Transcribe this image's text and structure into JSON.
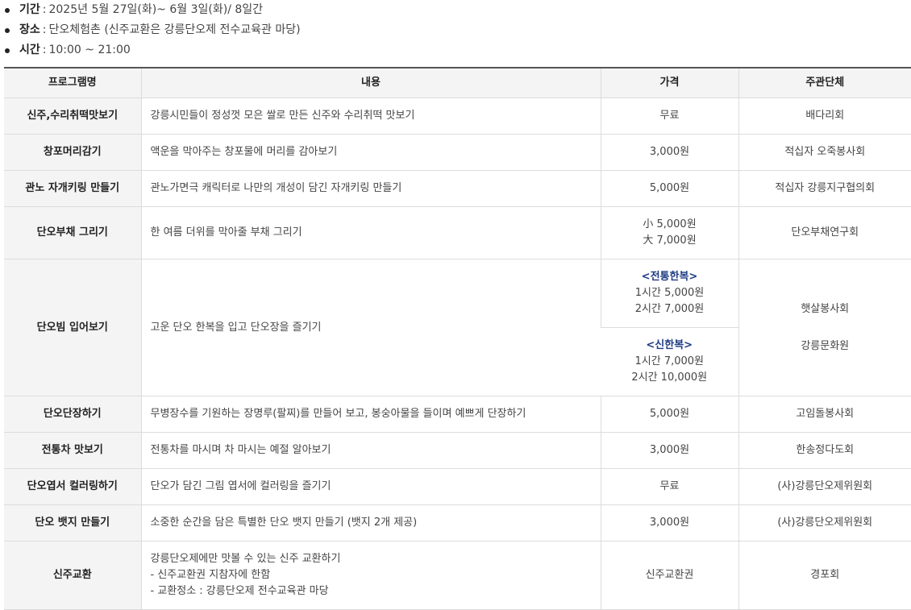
{
  "info": [
    {
      "label": "기간",
      "value": "2025년 5월 27일(화)~ 6월 3일(화)/ 8일간"
    },
    {
      "label": "장소",
      "value": "단오체험촌 (신주교환은 강릉단오제 전수교육관 마당)"
    },
    {
      "label": "시간",
      "value": "10:00 ~ 21:00"
    }
  ],
  "table": {
    "headers": [
      "프로그램명",
      "내용",
      "가격",
      "주관단체"
    ],
    "rows": [
      {
        "name": "신주,수리취떡맛보기",
        "content": "강릉시민들이 정성껏 모은 쌀로 만든 신주와 수리취떡 맛보기",
        "price": "무료",
        "org": "배다리회"
      },
      {
        "name": "창포머리감기",
        "content": "액운을 막아주는 창포물에 머리를 감아보기",
        "price": "3,000원",
        "org": "적십자 오죽봉사회"
      },
      {
        "name": "관노 자개키링 만들기",
        "content": "관노가면극 캐릭터로 나만의 개성이 담긴 자개키링 만들기",
        "price": "5,000원",
        "org": "적십자 강릉지구협의회"
      },
      {
        "name": "단오부채 그리기",
        "content": "한 여름 더위를 막아줄 부채 그리기",
        "price_lines": [
          "小 5,000원",
          "大 7,000원"
        ],
        "org": "단오부채연구회"
      },
      {
        "name": "단오빔 입어보기",
        "content": "고운 단오 한복을 입고 단오장을 즐기기",
        "price_a": {
          "category": "<전통한복>",
          "lines": [
            "1시간 5,000원",
            "2시간 7,000원"
          ]
        },
        "price_b": {
          "category": "<신한복>",
          "lines": [
            "1시간 7,000원",
            "2시간 10,000원"
          ]
        },
        "org_lines": [
          "햇살봉사회",
          "강릉문화원"
        ]
      },
      {
        "name": "단오단장하기",
        "content": "무병장수를 기원하는 장명루(팔찌)를 만들어 보고, 봉숭아물을 들이며 예쁘게 단장하기",
        "price": "5,000원",
        "org": "고임돌봉사회"
      },
      {
        "name": "전통차 맛보기",
        "content": "전통차를 마시며 차 마시는 예절 알아보기",
        "price": "3,000원",
        "org": "한송정다도회"
      },
      {
        "name": "단오엽서 컬러링하기",
        "content": "단오가 담긴 그림 엽서에 컬러링을 즐기기",
        "price": "무료",
        "org": "(사)강릉단오제위원회"
      },
      {
        "name": "단오 뱃지 만들기",
        "content": "소중한 순간을 담은 특별한 단오 뱃지 만들기 (뱃지 2개 제공)",
        "price": "3,000원",
        "org": "(사)강릉단오제위원회"
      },
      {
        "name": "신주교환",
        "content_lines": [
          "강릉단오제에만 맛볼 수 있는 신주 교환하기",
          "- 신주교환권 지참자에 한함",
          "- 교환정소 : 강릉단오제 전수교육관 마당"
        ],
        "price": "신주교환권",
        "org": "경포회"
      }
    ]
  }
}
